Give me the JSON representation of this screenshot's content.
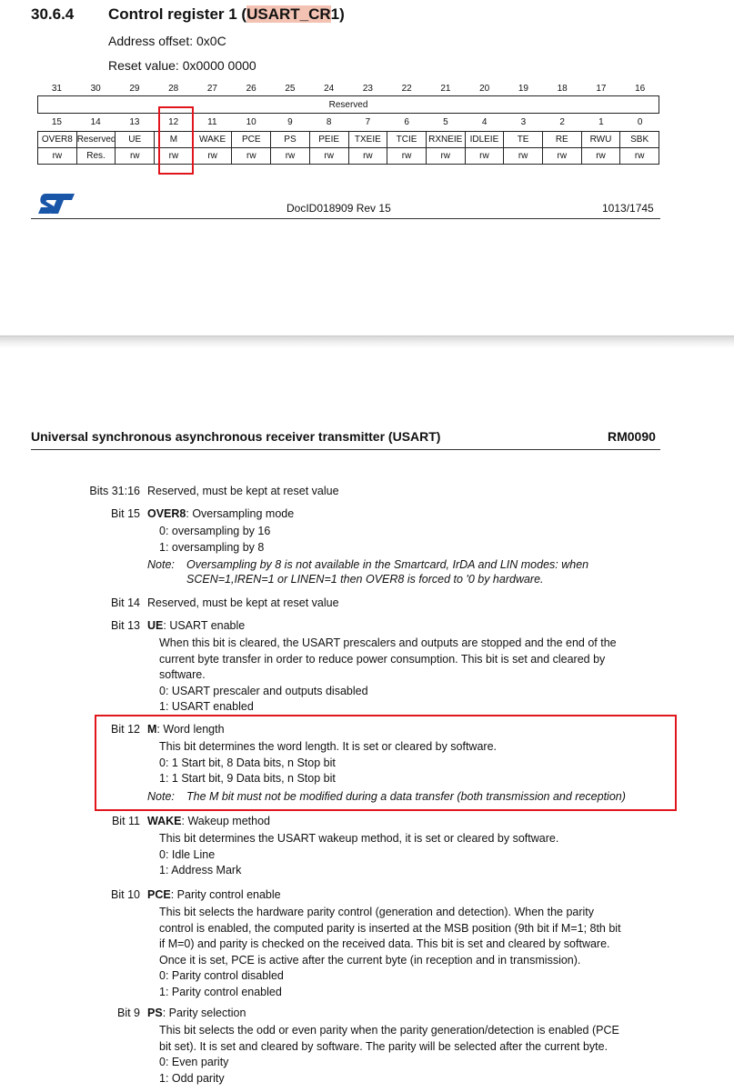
{
  "header": {
    "section_number": "30.6.4",
    "title_pre": "Control register 1 (",
    "title_hl": "USART_CR",
    "title_post": "1)",
    "address_offset": "Address offset: 0x0C",
    "reset_value": "Reset value: 0x0000 0000"
  },
  "register": {
    "upper_bits": [
      "31",
      "30",
      "29",
      "28",
      "27",
      "26",
      "25",
      "24",
      "23",
      "22",
      "21",
      "20",
      "19",
      "18",
      "17",
      "16"
    ],
    "upper_label": "Reserved",
    "lower_bits": [
      "15",
      "14",
      "13",
      "12",
      "11",
      "10",
      "9",
      "8",
      "7",
      "6",
      "5",
      "4",
      "3",
      "2",
      "1",
      "0"
    ],
    "fields": [
      "OVER8",
      "Reserved",
      "UE",
      "M",
      "WAKE",
      "PCE",
      "PS",
      "PEIE",
      "TXEIE",
      "TCIE",
      "RXNEIE",
      "IDLEIE",
      "TE",
      "RE",
      "RWU",
      "SBK"
    ],
    "access": [
      "rw",
      "Res.",
      "rw",
      "rw",
      "rw",
      "rw",
      "rw",
      "rw",
      "rw",
      "rw",
      "rw",
      "rw",
      "rw",
      "rw",
      "rw",
      "rw"
    ]
  },
  "footer": {
    "logo": "ST",
    "doc_id": "DocID018909 Rev 15",
    "page": "1013/1745"
  },
  "page2": {
    "header_title": "Universal synchronous asynchronous receiver transmitter (USART)",
    "header_ref": "RM0090",
    "bits": [
      {
        "label": "Bits 31:16",
        "lines": [
          "Reserved, must be kept at reset value"
        ]
      },
      {
        "label": "Bit 15",
        "name": "OVER8",
        "desc": ": Oversampling mode",
        "lines": [
          "0: oversampling by 16",
          "1: oversampling by 8"
        ],
        "note_label": "Note:",
        "note": [
          "Oversampling by 8 is not available in the Smartcard, IrDA and LIN modes: when",
          "SCEN=1,IREN=1 or LINEN=1 then OVER8 is forced to '0 by hardware."
        ]
      },
      {
        "label": "Bit 14",
        "lines": [
          "Reserved, must be kept at reset value"
        ]
      },
      {
        "label": "Bit 13",
        "name": "UE",
        "desc": ": USART enable",
        "lines": [
          "When this bit is cleared, the USART prescalers and outputs are stopped and the end of the",
          "current byte transfer in order to reduce power consumption. This bit is set and cleared by",
          "software.",
          "0: USART prescaler and outputs disabled",
          "1: USART enabled"
        ]
      },
      {
        "label": "Bit 12",
        "name": "M",
        "desc": ": Word length",
        "lines": [
          "This bit determines the word length. It is set or cleared by software.",
          "0: 1 Start bit, 8 Data bits, n Stop bit",
          "1: 1 Start bit, 9 Data bits, n Stop bit"
        ],
        "note_label": "Note:",
        "note": [
          "The M bit must not be modified during a data transfer (both transmission and reception)"
        ]
      },
      {
        "label": "Bit 11",
        "name": "WAKE",
        "desc": ": Wakeup method",
        "lines": [
          "This bit determines the USART wakeup method, it is set or cleared by software.",
          "0: Idle Line",
          "1: Address Mark"
        ]
      },
      {
        "label": "Bit 10",
        "name": "PCE",
        "desc": ": Parity control enable",
        "lines": [
          "This bit selects the hardware parity control (generation and detection). When the parity",
          "control is enabled, the computed parity is inserted at the MSB position (9th bit if M=1; 8th bit",
          "if M=0) and parity is checked on the received data. This bit is set and cleared by software.",
          "Once it is set, PCE is active after the current byte (in reception and in transmission).",
          "0: Parity control disabled",
          "1: Parity control enabled"
        ]
      },
      {
        "label": "Bit 9",
        "name": "PS",
        "desc": ": Parity selection",
        "lines": [
          "This bit selects the odd or even parity when the parity generation/detection is enabled (PCE",
          "bit set). It is set and cleared by software. The parity will be selected after the current byte.",
          "0: Even parity",
          "1: Odd parity"
        ]
      }
    ]
  },
  "colors": {
    "highlight_box": "#e0161c",
    "title_highlight": "#f3c2b3",
    "st_logo": "#1a56a8"
  }
}
